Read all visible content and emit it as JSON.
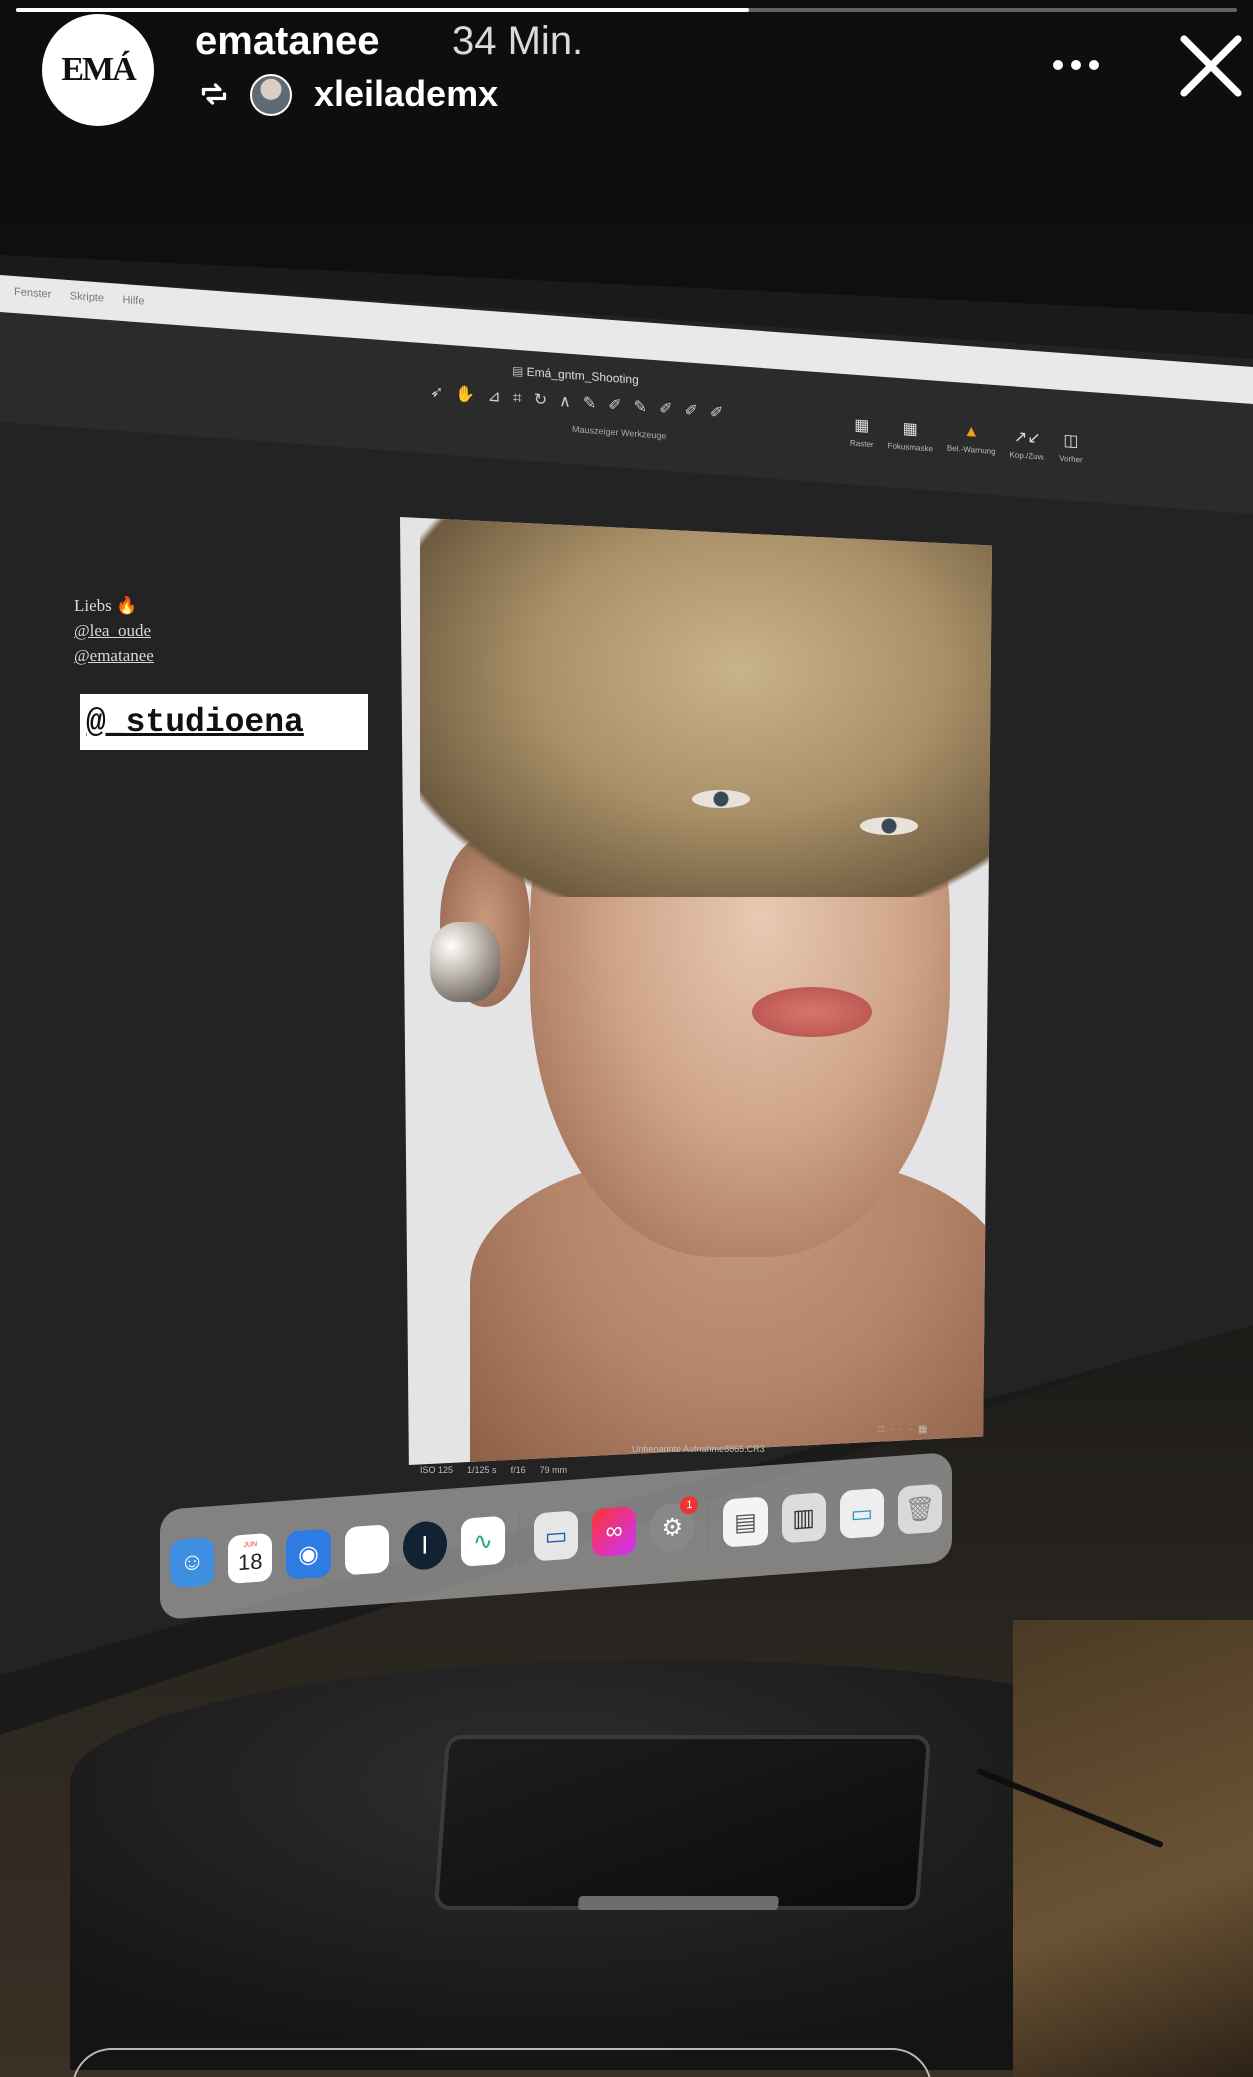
{
  "story": {
    "progress": 0.6,
    "author": {
      "avatar_text": "EMÁ",
      "username": "ematanee",
      "time_ago": "34 Min."
    },
    "repost": {
      "username": "xleilademx"
    },
    "sticker": {
      "mention": "@_studioena"
    }
  },
  "photo_content": {
    "screen_menu": [
      "Fenster",
      "Skripte",
      "Hilfe"
    ],
    "document_title": "Emá_gntm_Shooting",
    "tool_caption": "Mauszeiger Werkzeuge",
    "right_tools": [
      {
        "icon": "grid-icon",
        "label": "Raster"
      },
      {
        "icon": "focus-mask-icon",
        "label": "Fokusmaske"
      },
      {
        "icon": "warning-icon",
        "label": "Bel.-Warnung"
      },
      {
        "icon": "copy-apply-icon",
        "label": "Kop./Zuw."
      },
      {
        "icon": "before-after-icon",
        "label": "Vorher"
      }
    ],
    "caption_lines": [
      "Liebs 🔥",
      "@lea_oude",
      "@ematanee"
    ],
    "image_meta": [
      "ISO 125",
      "1/125 s",
      "f/16",
      "79 mm"
    ],
    "image_filename": "Unbenannte Aufnahme8865.CR3",
    "dock_calendar": {
      "month": "JUN",
      "day": "18"
    },
    "dock_badge": "1"
  },
  "colors": {
    "accent_orange": "#e9a13b",
    "sticker_bg": "#ffffff"
  }
}
